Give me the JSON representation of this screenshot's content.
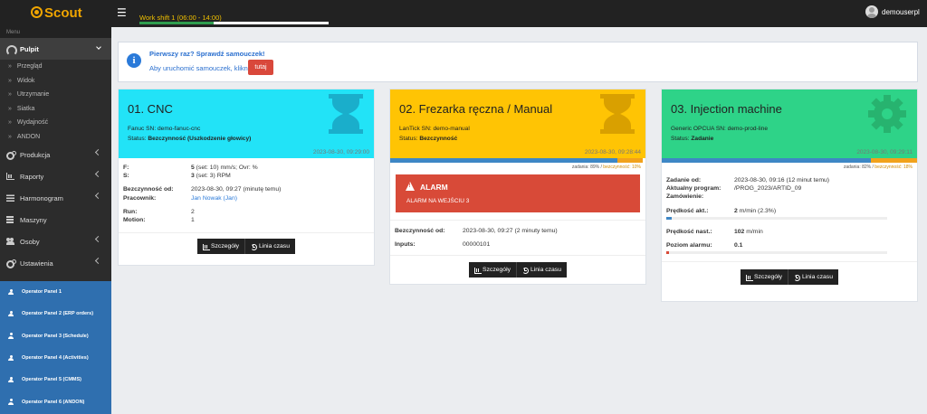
{
  "app": {
    "logo": "Scout",
    "username": "demouserpl"
  },
  "shift": {
    "label": "Work shift 1 (06:00 - 14:00)",
    "progress": 0.39
  },
  "sidebar": {
    "menu_header": "Menu",
    "pulpit": {
      "label": "Pulpit",
      "items": [
        "Przegląd",
        "Widok",
        "Utrzymanie",
        "Siatka",
        "Wydajność",
        "ANDON"
      ]
    },
    "main_items": [
      "Produkcja",
      "Raporty",
      "Harmonogram",
      "Maszyny",
      "Osoby",
      "Ustawienia"
    ],
    "operator_panels": [
      "Operator Panel 1",
      "Operator Panel 2 (ERP orders)",
      "Operator Panel 3 (Schedule)",
      "Operator Panel 4 (Activities)",
      "Operator Panel 5 (CMMS)",
      "Operator Panel 6 (ANDON)"
    ]
  },
  "info": {
    "title": "Pierwszy raz? Sprawdź samouczek!",
    "text": "Aby uruchomić samouczek, kliknij",
    "button": "tutaj"
  },
  "colors": {
    "cyan": "#22e3f7",
    "yellow": "#ffc404",
    "green": "#2ed388",
    "blue_strip": "#3e87c5",
    "orange_strip": "#f1a21c"
  },
  "cards": [
    {
      "title": "01. CNC",
      "sn": "Fanuc SN: demo-fanuc-cnc",
      "status_label": "Status:",
      "status": "Bezczynność (Uszkodzenie głowicy)",
      "time": "2023-08-30, 09:29:00",
      "rows": [
        {
          "k": "F:",
          "v_bold": "5",
          "v": " (set: 10) mm/s; Ovr: %"
        },
        {
          "k": "S:",
          "v_bold": "3",
          "v": " (set: 3) RPM"
        },
        {
          "k": "Bezczynność od:",
          "v": "2023-08-30, 09:27 (minutę temu)"
        },
        {
          "k": "Pracownik:",
          "v": "Jan Nowak (Jan)"
        },
        {
          "k": "Run:",
          "v": "2"
        },
        {
          "k": "Motion:",
          "v": "1"
        }
      ],
      "buttons": [
        "Szczegóły",
        "Linia czasu"
      ]
    },
    {
      "title": "02. Frezarka ręczna / Manual",
      "sn": "LanTick SN: demo-manual",
      "status_label": "Status:",
      "status": "Bezczynność",
      "time": "2023-08-30, 09:28:44",
      "strip": {
        "tasks_label": "zadania:",
        "tasks": "89%",
        "idle_label": "bezczynność:",
        "idle": "10%",
        "tasks_value": 89,
        "idle_value": 10
      },
      "alarm": {
        "title": "ALARM",
        "text": "ALARM NA WEJŚCIU 3"
      },
      "rows": [
        {
          "k": "Bezczynność od:",
          "v": "2023-08-30, 09:27 (2 minuty temu)"
        },
        {
          "k": "Inputs:",
          "v": "00000101"
        }
      ],
      "buttons": [
        "Szczegóły",
        "Linia czasu"
      ]
    },
    {
      "title": "03. Injection machine",
      "sn": "Generic OPCUA SN: demo-prod-line",
      "status_label": "Status:",
      "status": "Zadanie",
      "time": "2023-08-30, 09:29:11",
      "strip": {
        "tasks_label": "zadania:",
        "tasks": "82%",
        "idle_label": "bezczynność:",
        "idle": "18%",
        "tasks_value": 82,
        "idle_value": 18
      },
      "rows": [
        {
          "k": "Zadanie od:",
          "v": "2023-08-30, 09:16 (12 minut temu)"
        },
        {
          "k": "Aktualny program:",
          "v": "/PROG_2023/ARTID_09"
        },
        {
          "k": "Zamówienie:",
          "v": ""
        }
      ],
      "speed_current": {
        "k": "Prędkość akt.:",
        "v_bold": "2",
        "v": " m/min (2.3%)",
        "fraction": 0.023
      },
      "speed_set": {
        "k": "Prędkość nast.:",
        "v_bold": "102",
        "v": " m/min"
      },
      "alarm_level": {
        "k": "Poziom alarmu:",
        "v_bold": "0.1",
        "fraction": 0.012
      },
      "buttons": [
        "Szczegóły",
        "Linia czasu"
      ]
    }
  ]
}
